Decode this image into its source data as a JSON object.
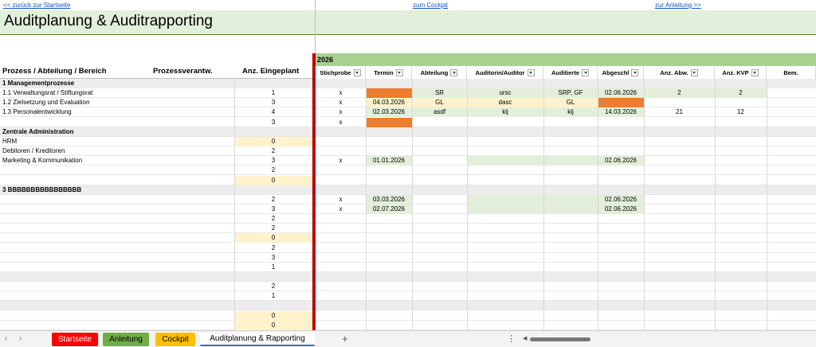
{
  "nav": {
    "back_link": "<< zurück zur Startseite",
    "cockpit_link": "zum Cockpit",
    "guide_link": "zur Anleitung >>"
  },
  "title": "Auditplanung & Auditrapporting",
  "year": "2026",
  "left_headers": {
    "prozess": "Prozess / Abteilung / Bereich",
    "verantw": "Prozessverantw.",
    "anz": "Anz. Eingeplant"
  },
  "right_headers": [
    "Stichprobe",
    "Termin",
    "Abteilung",
    "Auditorin/Auditor",
    "Auditierte",
    "Abgeschl",
    "Anz. Abw.",
    "Anz. KVP",
    "Bem."
  ],
  "rows": [
    {
      "label": "1 Managementprozesse",
      "group": true
    },
    {
      "label": "1.1 Verwaltungsrat / Stiftungsrat",
      "anz": "1",
      "stich": "x",
      "termin": "",
      "abt": "SR",
      "aud": "ursc",
      "audt": "SRP, GF",
      "abg": "02.06.2026",
      "abw": "2",
      "kvp": "2"
    },
    {
      "label": "1.2 Zielsetzung und Evaluation",
      "anz": "3",
      "stich": "x",
      "termin": "04.03.2026",
      "abt": "GL",
      "aud": "dasc",
      "audt": "GL",
      "abg": ""
    },
    {
      "label": "1.3 Personalentwicklung",
      "anz": "4",
      "stich": "x",
      "termin": "02.03.2026",
      "abt": "asdf",
      "aud": "klj",
      "audt": "klj",
      "abg": "14.03.2026",
      "abw": "21",
      "kvp": "12"
    },
    {
      "label": "",
      "anz": "3",
      "stich": "x",
      "termin": ""
    },
    {
      "label": "Zentrale Administration",
      "group": true
    },
    {
      "label": "HRM",
      "anz": "0"
    },
    {
      "label": "Debitoren / Kreditoren",
      "anz": "2"
    },
    {
      "label": "Marketing & Kommunikation",
      "anz": "3",
      "stich": "x",
      "termin": "01.01.2026",
      "abg": "02.06.2026"
    },
    {
      "label": "",
      "anz": "2"
    },
    {
      "label": "",
      "anz": "0"
    },
    {
      "label": "3 BBBBBBBBBBBBBBBB",
      "group": true
    },
    {
      "label": "",
      "anz": "2",
      "stich": "x",
      "termin": "03.03.2026",
      "abg": "02.06.2026"
    },
    {
      "label": "",
      "anz": "3",
      "stich": "x",
      "termin": "02.07.2026",
      "abg": "02.06.2026"
    },
    {
      "label": "",
      "anz": "2"
    },
    {
      "label": "",
      "anz": "2"
    },
    {
      "label": "",
      "anz": "0"
    },
    {
      "label": "",
      "anz": "2"
    },
    {
      "label": "",
      "anz": "3"
    },
    {
      "label": "",
      "anz": "1"
    },
    {
      "label": "",
      "anz": "",
      "group": true
    },
    {
      "label": "",
      "anz": "2"
    },
    {
      "label": "",
      "anz": "1"
    },
    {
      "label": "",
      "anz": "",
      "group": true
    },
    {
      "label": "",
      "anz": "0"
    },
    {
      "label": "",
      "anz": "0"
    }
  ],
  "tabs": [
    {
      "label": "Startseite",
      "color": "#ff0000"
    },
    {
      "label": "Anleitung",
      "color": "#70ad47"
    },
    {
      "label": "Cockpit",
      "color": "#ffc000"
    },
    {
      "label": "Auditplanung & Rapporting",
      "color": "#ffffff"
    }
  ],
  "colors": {
    "header_green": "#e2efda",
    "band_green": "#a9d08e",
    "accent_red": "#c00000",
    "orange": "#ed7d31",
    "cream": "#fff2cc"
  },
  "icons": {
    "add": "+",
    "more": "⋮",
    "scroll_left": "◀",
    "prev_sheet": "‹",
    "next_sheet": "›"
  }
}
